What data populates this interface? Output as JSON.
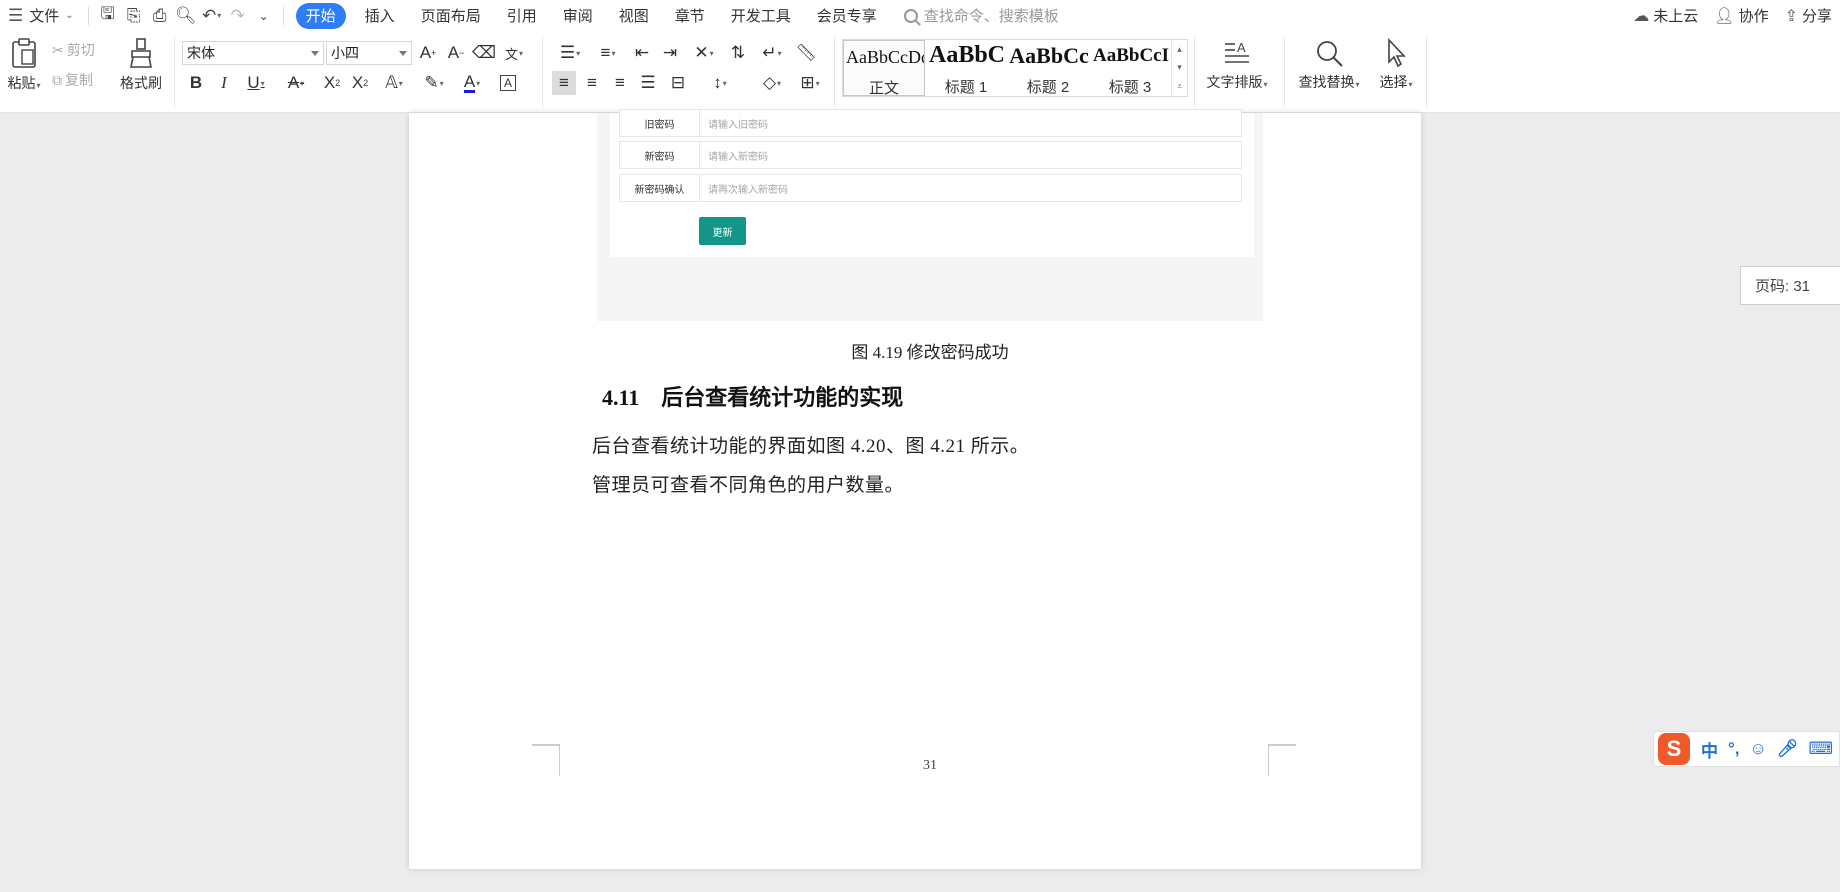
{
  "menubar": {
    "file_label": "文件",
    "tabs": [
      "开始",
      "插入",
      "页面布局",
      "引用",
      "审阅",
      "视图",
      "章节",
      "开发工具",
      "会员专享"
    ],
    "active_tab": "开始",
    "search_placeholder": "查找命令、搜索模板",
    "cloud_label": "未上云",
    "collab_label": "协作",
    "share_label": "分享"
  },
  "ribbon": {
    "paste": "粘贴",
    "cut": "剪切",
    "copy": "复制",
    "format_painter": "格式刷",
    "font_name": "宋体",
    "font_size": "小四",
    "styles": [
      {
        "sample": "AaBbCcDd",
        "name": "正文"
      },
      {
        "sample": "AaBbC",
        "name": "标题 1"
      },
      {
        "sample": "AaBbCc",
        "name": "标题 2"
      },
      {
        "sample": "AaBbCcI",
        "name": "标题 3"
      }
    ],
    "text_layout": "文字排版",
    "find_replace": "查找替换",
    "select": "选择"
  },
  "document": {
    "form": {
      "rows": [
        {
          "label": "旧密码",
          "placeholder": "请输入旧密码"
        },
        {
          "label": "新密码",
          "placeholder": "请输入新密码"
        },
        {
          "label": "新密码确认",
          "placeholder": "请再次输入新密码"
        }
      ],
      "button": "更新"
    },
    "caption": "图 4.19  修改密码成功",
    "heading": "4.11    后台查看统计功能的实现",
    "paragraphs": [
      "后台查看统计功能的界面如图 4.20、图 4.21 所示。",
      "管理员可查看不同角色的用户数量。"
    ],
    "page_number": "31"
  },
  "page_indicator": "页码: 31",
  "ime": {
    "lang": "中",
    "punct": "°,"
  }
}
